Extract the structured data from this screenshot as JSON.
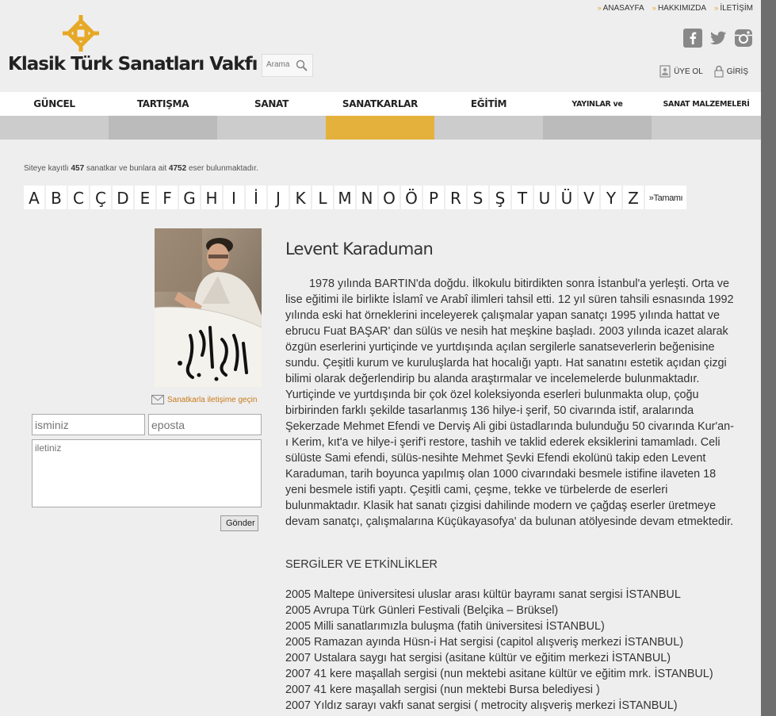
{
  "toplinks": [
    "ANASAYFA",
    "HAKKIMIZDA",
    "İLETİŞİM"
  ],
  "logo": {
    "text": "Klasik Türk Sanatları Vakfı"
  },
  "search": {
    "placeholder": "Arama"
  },
  "user_actions": {
    "register": "ÜYE OL",
    "login": "GİRİŞ"
  },
  "nav": [
    {
      "label": "GÜNCEL",
      "color": "#cccccc"
    },
    {
      "label": "TARTIŞMA",
      "color": "#bbbbbb"
    },
    {
      "label": "SANAT",
      "color": "#cccccc"
    },
    {
      "label": "SANATKARLAR",
      "color": "#e5b13d"
    },
    {
      "label": "EĞİTİM",
      "color": "#cccccc"
    },
    {
      "label": "YAYINLAR ve KOLEKSİYONLAR",
      "color": "#bbbbbb"
    },
    {
      "label": "SANAT MALZEMELERİ",
      "color": "#cccccc"
    }
  ],
  "stats": {
    "prefix": "Siteye kayıtlı",
    "artists": "457",
    "middle": "sanatkar ve bunlara ait",
    "works": "4752",
    "suffix": "eser bulunmaktadır."
  },
  "letters": [
    "A",
    "B",
    "C",
    "Ç",
    "D",
    "E",
    "F",
    "G",
    "H",
    "I",
    "İ",
    "J",
    "K",
    "L",
    "M",
    "N",
    "O",
    "Ö",
    "P",
    "R",
    "S",
    "Ş",
    "T",
    "U",
    "Ü",
    "V",
    "Y",
    "Z"
  ],
  "all_label": "»Tamamı",
  "contact": {
    "link": "Sanatkarla iletişime geçin",
    "name_placeholder": "isminiz",
    "email_placeholder": "eposta",
    "message_placeholder": "iletiniz",
    "send": "Gönder"
  },
  "artist": {
    "name": "Levent Karaduman",
    "bio": "1978 yılında BARTIN'da doğdu. İlkokulu bitirdikten sonra İstanbul'a yerleşti. Orta ve lise eğitimi ile birlikte İslamî ve Arabî ilimleri tahsil etti. 12 yıl süren tahsili esnasında 1992 yılında eski hat örneklerini inceleyerek çalışmalar yapan sanatçı 1995 yılında hattat ve ebrucu Fuat BAŞAR' dan sülüs ve nesih hat meşkine başladı. 2003 yılında icazet alarak özgün eserlerini yurtiçinde ve yurtdışında açılan sergilerle sanatseverlerin beğenisine sundu. Çeşitli kurum ve kuruluşlarda hat hocalığı yaptı. Hat sanatını estetik açıdan çizgi bilimi olarak değerlendirip bu alanda araştırmalar ve incelemelerde bulunmaktadır. Yurtiçinde ve yurtdışında bir çok özel koleksiyonda eserleri bulunmakta olup, çoğu birbirinden farklı şekilde tasarlanmış 136 hilye-i şerif, 50 civarında istif, aralarında Şekerzade Mehmet Efendi ve Derviş Ali gibi üstadlarında bulunduğu 50 civarında Kur'an-ı Kerim, kıt'a ve hilye-i şerif'i restore, tashih ve taklid ederek eksiklerini tamamladı. Celi sülüste Sami efendi, sülüs-nesihte Mehmet Şevki Efendi ekolünü takip eden Levent Karaduman, tarih boyunca yapılmış olan 1000 civarındaki besmele istifine ilaveten 18 yeni besmele istifi yaptı. Çeşitli cami, çeşme, tekke ve türbelerde de eserleri bulunmaktadır. Klasik hat sanatı çizgisi dahilinde modern ve çağdaş eserler üretmeye devam sanatçı, çalışmalarına Küçükayasofya' da bulunan atölyesinde devam etmektedir.",
    "section_title": "SERGİLER VE ETKİNLİKLER",
    "exhibitions": [
      "2005 Maltepe üniversitesi uluslar arası kültür bayramı sanat sergisi İSTANBUL",
      "2005 Avrupa Türk Günleri Festivali (Belçika – Brüksel)",
      "2005 Milli sanatlarımızla buluşma (fatih üniversitesi İSTANBUL)",
      "2005 Ramazan ayında Hüsn-i Hat sergisi (capitol alışveriş merkezi İSTANBUL)",
      "2007 Ustalara saygı hat sergisi (asitane kültür ve eğitim merkezi İSTANBUL)",
      "2007 41 kere maşallah sergisi (nun mektebi asitane kültür ve eğitim mrk. İSTANBUL)",
      "2007 41 kere maşallah sergisi (nun mektebi Bursa belediyesi )",
      "2007 Yıldız sarayı vakfı sanat sergisi ( metrocity alışveriş merkezi İSTANBUL)"
    ]
  },
  "colors": {
    "accent": "#e6a825",
    "link": "#c87a1a",
    "background": "#eeeeee"
  }
}
